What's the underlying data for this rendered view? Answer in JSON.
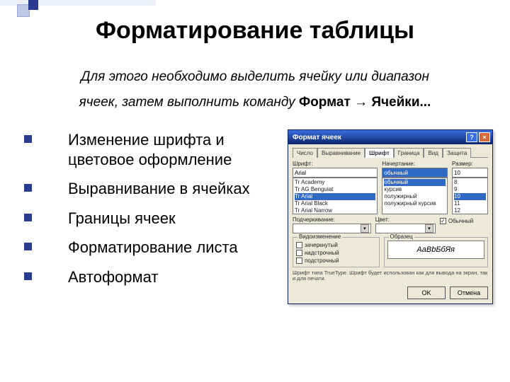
{
  "title": "Форматирование таблицы",
  "intro": {
    "line1": "Для этого необходимо выделить ячейку или диапазон",
    "line2a": "ячеек, затем выполнить команду ",
    "kw1": "Формат",
    "arrow": " → ",
    "kw2": "Ячейки..."
  },
  "bullets": [
    "Изменение шрифта и цветовое оформление",
    "Выравнивание в ячейках",
    "Границы ячеек",
    "Форматирование листа",
    "Автоформат"
  ],
  "dialog": {
    "caption": "Формат ячеек",
    "help": "?",
    "close": "×",
    "tabs": [
      "Число",
      "Выравнивание",
      "Шрифт",
      "Граница",
      "Вид",
      "Защита"
    ],
    "activeTab": 2,
    "font": {
      "label": "Шрифт:",
      "value": "Arial",
      "items": [
        "Tr Academy",
        "Tr AG Benguiat",
        "Tr Arial",
        "Tr Arial Black",
        "Tr Arial Narrow"
      ]
    },
    "style": {
      "label": "Начертание:",
      "value": "обычный",
      "items": [
        "обычный",
        "курсив",
        "полужирный",
        "полужирный курсив"
      ]
    },
    "size": {
      "label": "Размер:",
      "value": "10",
      "items": [
        "8",
        "9",
        "10",
        "11",
        "12"
      ]
    },
    "underline": {
      "label": "Подчеркивание:",
      "value": " "
    },
    "color": {
      "label": "Цвет:",
      "value": " "
    },
    "normalFont": {
      "label": "Обычный",
      "checked": true
    },
    "groupUnderline": "Видоизменение",
    "strike": "зачеркнутый",
    "superscript": "надстрочный",
    "subscript": "подстрочный",
    "groupPreview": "Образец",
    "previewText": "АаBbБбЯя",
    "hint": "Шрифт типа TrueType. Шрифт будет использован как для вывода на экран, так и для печати.",
    "ok": "OK",
    "cancel": "Отмена"
  }
}
